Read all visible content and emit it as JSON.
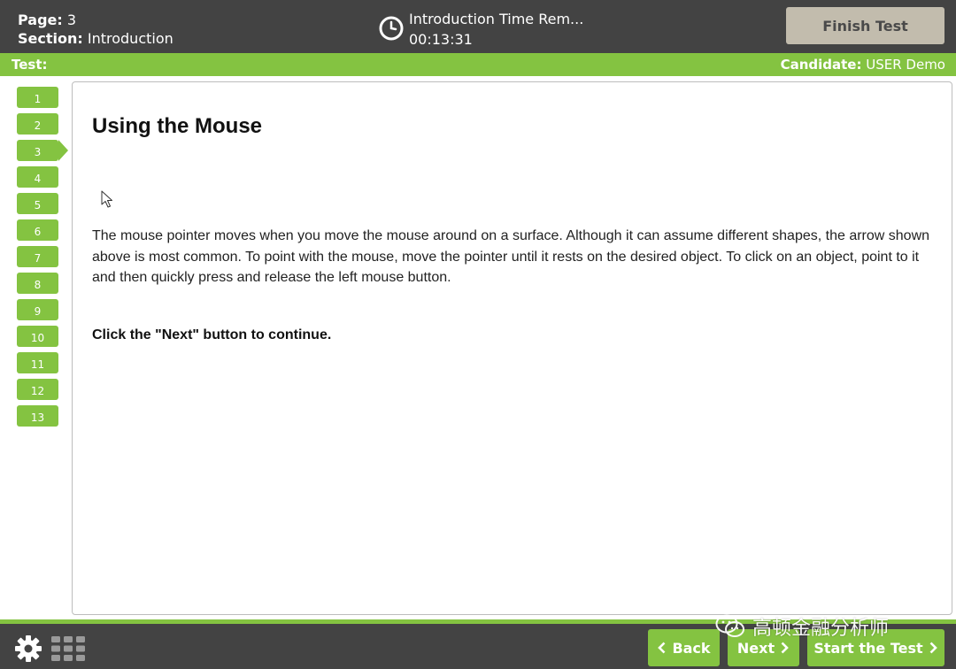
{
  "header": {
    "page_label": "Page:",
    "page_value": "3",
    "section_label": "Section:",
    "section_value": "Introduction",
    "timer_title": "Introduction Time Rem...",
    "timer_value": "00:13:31",
    "finish_label": "Finish Test"
  },
  "greenbar": {
    "test_label": "Test:",
    "candidate_label": "Candidate:",
    "candidate_value": "USER Demo"
  },
  "nav": {
    "current": "3",
    "items": [
      "1",
      "2",
      "3",
      "4",
      "5",
      "6",
      "7",
      "8",
      "9",
      "10",
      "11",
      "12",
      "13"
    ]
  },
  "content": {
    "title": "Using the Mouse",
    "paragraph": "The mouse pointer moves when you move the mouse around on a surface. Although it can assume different shapes, the arrow shown above is most common. To point with the mouse, move the pointer until it rests on the desired object. To click on an object, point to it and then quickly press and release the left mouse button.",
    "instruction": "Click the \"Next\" button to continue."
  },
  "footer": {
    "back_label": "Back",
    "next_label": "Next",
    "start_label": "Start the Test"
  },
  "watermark": {
    "text": "高顿金融分析师"
  },
  "colors": {
    "header_bg": "#434343",
    "accent_green": "#84c341",
    "finish_button": "#c2bcad"
  },
  "icons": [
    "clock-icon",
    "pointer-icon",
    "gear-icon",
    "grid-icon",
    "chevron-left-icon",
    "chevron-right-icon",
    "wechat-icon"
  ]
}
